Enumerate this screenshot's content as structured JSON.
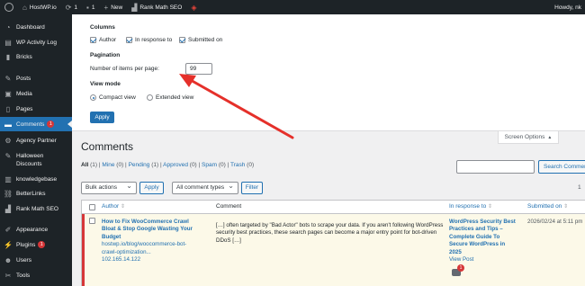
{
  "adminbar": {
    "site_name": "HostWP.io",
    "updates_count": "1",
    "comments_count": "1",
    "new_label": "New",
    "rankmath_label": "Rank Math SEO",
    "greeting": "Howdy, nk"
  },
  "sidebar": {
    "items": [
      {
        "label": "Dashboard",
        "icon": "gauge-icon"
      },
      {
        "label": "WP Activity Log",
        "icon": "activity-log-icon"
      },
      {
        "label": "Bricks",
        "icon": "bricks-icon"
      },
      {
        "label": "Posts",
        "icon": "pin-icon"
      },
      {
        "label": "Media",
        "icon": "media-icon"
      },
      {
        "label": "Pages",
        "icon": "page-icon"
      },
      {
        "label": "Comments",
        "icon": "comment-icon",
        "badge": "1"
      },
      {
        "label": "Agency Partner",
        "icon": "partner-icon"
      },
      {
        "label": "Halloween Discounts",
        "icon": "pin-icon"
      },
      {
        "label": "knowledgebase",
        "icon": "book-icon"
      },
      {
        "label": "BetterLinks",
        "icon": "link-icon"
      },
      {
        "label": "Rank Math SEO",
        "icon": "rankmath-icon"
      },
      {
        "label": "Appearance",
        "icon": "brush-icon"
      },
      {
        "label": "Plugins",
        "icon": "plugin-icon",
        "badge": "1"
      },
      {
        "label": "Users",
        "icon": "user-icon"
      },
      {
        "label": "Tools",
        "icon": "wrench-icon"
      }
    ]
  },
  "screen_options": {
    "columns_heading": "Columns",
    "columns": [
      {
        "label": "Author",
        "checked": true
      },
      {
        "label": "In response to",
        "checked": true
      },
      {
        "label": "Submitted on",
        "checked": true
      }
    ],
    "pagination_heading": "Pagination",
    "per_page_label": "Number of items per page:",
    "per_page_value": "99",
    "view_mode_heading": "View mode",
    "view_modes": [
      {
        "label": "Compact view",
        "checked": true
      },
      {
        "label": "Extended view",
        "checked": false
      }
    ],
    "apply_label": "Apply",
    "tab_label": "Screen Options",
    "tab_arrow": "▲"
  },
  "comments": {
    "title": "Comments",
    "filters": {
      "all": "All",
      "all_count": "(1)",
      "mine": "Mine",
      "mine_count": "(0)",
      "pending": "Pending",
      "pending_count": "(1)",
      "approved": "Approved",
      "approved_count": "(0)",
      "spam": "Spam",
      "spam_count": "(0)",
      "trash": "Trash",
      "trash_count": "(0)"
    },
    "search_button": "Search Comments",
    "bulk_actions": "Bulk actions",
    "apply_label": "Apply",
    "comment_types": "All comment types",
    "filter_label": "Filter",
    "page_count": "1"
  },
  "table": {
    "headers": {
      "author": "Author",
      "comment": "Comment",
      "in_response_to": "In response to",
      "submitted_on": "Submitted on"
    },
    "rows": [
      {
        "author_line1": "How to Fix WooCommerce Crawl",
        "author_line2": "Bloat & Stop Google Wasting Your",
        "author_line3": "Budget",
        "author_url1": "hostwp.io/blog/woocommerce-bot-",
        "author_url2": "crawl-optimization...",
        "author_ip": "102.165.14.122",
        "comment_line1": "[…] often targeted by \"Bad Actor\" bots to scrape your data. If you aren't following WordPress",
        "comment_line2": "security best practices, these search pages can become a major entry point for bot-driven",
        "comment_line3": "DDoS […]",
        "response_line1": "WordPress Security Best",
        "response_line2": "Practices and Tips –",
        "response_line3": "Complete Guide To",
        "response_line4": "Secure WordPress in",
        "response_line5": "2025",
        "view_post": "View Post",
        "pending_bubble": "1",
        "submitted": "2026/02/24 at 5:11 pm"
      }
    ]
  }
}
